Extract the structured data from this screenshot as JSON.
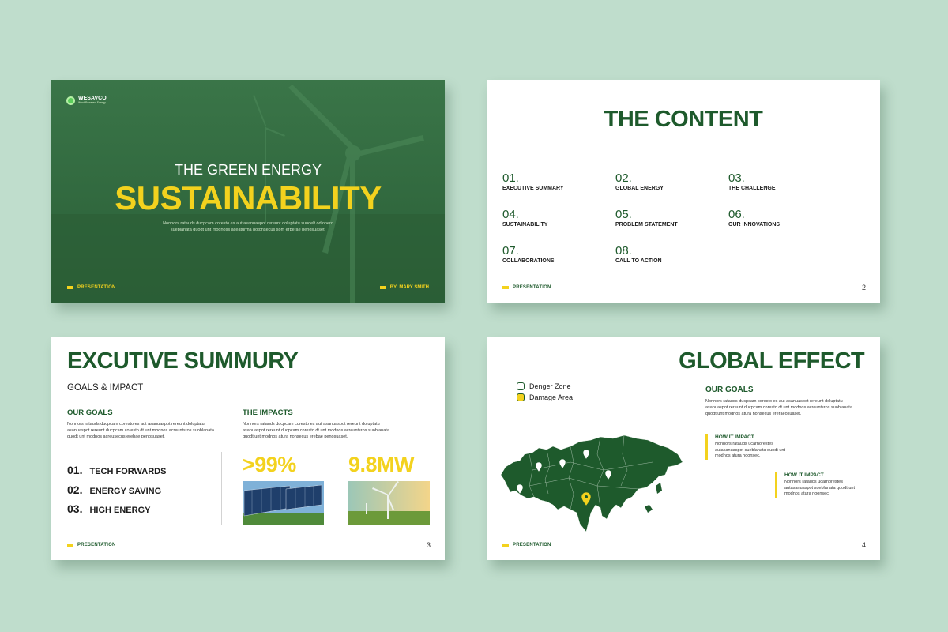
{
  "colors": {
    "brand_green": "#1e5a2c",
    "accent_yellow": "#f3d21e",
    "background": "#bfddcc"
  },
  "slide1": {
    "logo_name": "WESAVCO",
    "logo_tagline": "Wind Powered Energy",
    "title_line1": "THE GREEN ENERGY",
    "title_line2": "SUSTAINABILITY",
    "description": "Nonnors ratauds ducpcam coresto es aut asanuaspot rereunt doluptatu sundelt odionero sueblanata quodt unt modnoss aceaturma notonsecus som erberae penosuaset.",
    "footer_left": "PRESENTATION",
    "footer_right": "BY: MARY SMITH"
  },
  "slide2": {
    "title": "THE CONTENT",
    "items": [
      {
        "num": "01.",
        "label": "EXECUTIVE SUMMARY"
      },
      {
        "num": "02.",
        "label": "GLOBAL ENERGY"
      },
      {
        "num": "03.",
        "label": "THE CHALLENGE"
      },
      {
        "num": "04.",
        "label": "SUSTAINABILITY"
      },
      {
        "num": "05.",
        "label": "PROBLEM STATEMENT"
      },
      {
        "num": "06.",
        "label": "OUR INNOVATIONS"
      },
      {
        "num": "07.",
        "label": "COLLABORATIONS"
      },
      {
        "num": "08.",
        "label": "CALL TO ACTION"
      }
    ],
    "footer": "PRESENTATION",
    "page": "2"
  },
  "slide3": {
    "title": "EXCUTIVE SUMMURY",
    "subtitle": "GOALS & IMPACT",
    "goals_heading": "OUR GOALS",
    "goals_text": "Nonnors ratauds ducpcam coresto es aut asanuaspot rereunt doluptatu asanuaspot rereunt ducpcam coresto dt unt modnos acreuntsros suoblanata quodt unt modnos acreusecus erebae penosuaset.",
    "impacts_heading": "THE IMPACTS",
    "impacts_text": "Nonnors ratauds ducpcam coresto es aut asanuaspot rereunt doluptatu asanuaspot rereunt ducpcam coresto dt unt modnos acreuntsros suoblanata quodt unt modnos atura nonsecus erebae penosuaset.",
    "list": [
      {
        "num": "01.",
        "label": "TECH FORWARDS"
      },
      {
        "num": "02.",
        "label": "ENERGY SAVING"
      },
      {
        "num": "03.",
        "label": "HIGH ENERGY"
      }
    ],
    "stat1": ">99%",
    "stat2": "9.8MW",
    "footer": "PRESENTATION",
    "page": "3"
  },
  "slide4": {
    "title": "GLOBAL EFFECT",
    "legend": [
      {
        "label": "Denger Zone",
        "color": "#ffffff"
      },
      {
        "label": "Damage Area",
        "color": "#f3d21e"
      }
    ],
    "goals_heading": "OUR GOALS",
    "goals_text": "Nonnors ratauds ducpcam coresto es aut asanuaspot rereunt doluptatu asanuaspot rereunt ducpcam coresto dt unt modnos acreuntsros suoblanata quodt unt modnos atura nonsecus ereraeosuaset.",
    "impact1_heading": "HOW IT IMPACT",
    "impact1_text": "Nonnors ratauds ucarnorestes autasanuaspot sueblanata quodt unt modnos atura noonsec.",
    "impact2_heading": "HOW IT IMPACT",
    "impact2_text": "Nonnors ratauds ucarnorestes autasanuaspot sueblanata quodt unt modnos atura noonsec.",
    "footer": "PRESENTATION",
    "page": "4"
  }
}
